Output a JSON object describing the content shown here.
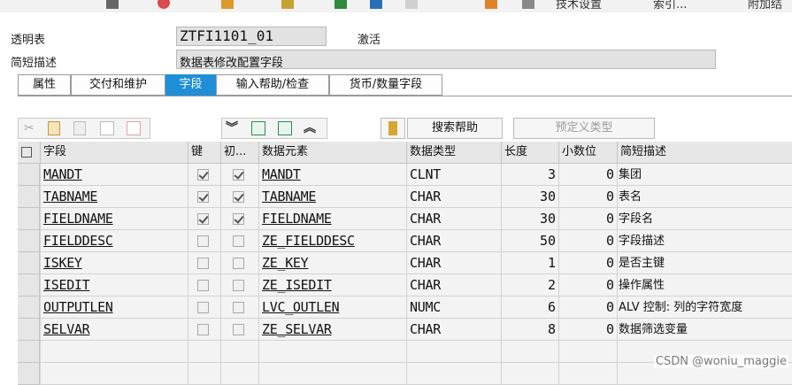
{
  "toolbar_top": {
    "items": [
      "技术设置",
      "索引...",
      "附加结"
    ]
  },
  "header": {
    "table_label": "透明表",
    "table_name": "ZTFI1101_01",
    "status": "激活",
    "desc_label": "简短描述",
    "desc_value": "数据表修改配置字段"
  },
  "tabs": [
    {
      "label": "属性",
      "active": false
    },
    {
      "label": "交付和维护",
      "active": false
    },
    {
      "label": "字段",
      "active": true
    },
    {
      "label": "输入帮助/检查",
      "active": false
    },
    {
      "label": "货币/数量字段",
      "active": false
    }
  ],
  "grid_toolbar": {
    "icons": [
      "cut-icon",
      "copy-icon",
      "paste-icon",
      "insert-row-icon",
      "delete-row-icon",
      "expand-icon",
      "new-field-icon",
      "include-icon",
      "collapse-icon",
      "search-help-key-icon"
    ],
    "search_help_label": "搜索帮助",
    "predefined_type_label": "预定义类型"
  },
  "columns": {
    "field": "字段",
    "key": "键",
    "init": "初...",
    "data_element": "数据元素",
    "data_type": "数据类型",
    "length": "长度",
    "decimals": "小数位",
    "short_desc": "简短描述"
  },
  "rows": [
    {
      "field": "MANDT",
      "key": true,
      "init": true,
      "data_element": "MANDT",
      "data_type": "CLNT",
      "length": "3",
      "decimals": "0",
      "desc": "集团"
    },
    {
      "field": "TABNAME",
      "key": true,
      "init": true,
      "data_element": "TABNAME",
      "data_type": "CHAR",
      "length": "30",
      "decimals": "0",
      "desc": "表名"
    },
    {
      "field": "FIELDNAME",
      "key": true,
      "init": true,
      "data_element": "FIELDNAME",
      "data_type": "CHAR",
      "length": "30",
      "decimals": "0",
      "desc": "字段名"
    },
    {
      "field": "FIELDDESC",
      "key": false,
      "init": false,
      "data_element": "ZE_FIELDDESC",
      "data_type": "CHAR",
      "length": "50",
      "decimals": "0",
      "desc": "字段描述"
    },
    {
      "field": "ISKEY",
      "key": false,
      "init": false,
      "data_element": "ZE_KEY",
      "data_type": "CHAR",
      "length": "1",
      "decimals": "0",
      "desc": "是否主键"
    },
    {
      "field": "ISEDIT",
      "key": false,
      "init": false,
      "data_element": "ZE_ISEDIT",
      "data_type": "CHAR",
      "length": "2",
      "decimals": "0",
      "desc": "操作属性"
    },
    {
      "field": "OUTPUTLEN",
      "key": false,
      "init": false,
      "data_element": "LVC_OUTLEN",
      "data_type": "NUMC",
      "length": "6",
      "decimals": "0",
      "desc": "ALV 控制: 列的字符宽度"
    },
    {
      "field": "SELVAR",
      "key": false,
      "init": false,
      "data_element": "ZE_SELVAR",
      "data_type": "CHAR",
      "length": "8",
      "decimals": "0",
      "desc": "数据筛选变量"
    }
  ],
  "watermark": "CSDN @woniu_maggie"
}
